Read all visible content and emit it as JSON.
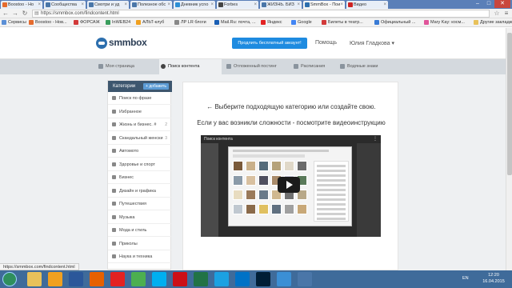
{
  "browser": {
    "tabs": [
      {
        "label": "Boostoo - Нo",
        "color": "#e56b2e"
      },
      {
        "label": "Сообщества",
        "color": "#4a76a8"
      },
      {
        "label": "Смотри и уд",
        "color": "#4a76a8"
      },
      {
        "label": "Полезное обс",
        "color": "#4a76a8"
      },
      {
        "label": "Дневник ycno",
        "color": "#2d8fd5"
      },
      {
        "label": "Forbes",
        "color": "#444444"
      },
      {
        "label": "ЖИЗНЬ. БИЗ",
        "color": "#4a76a8"
      },
      {
        "label": "SmmBox - Пои",
        "color": "#2d6fae"
      },
      {
        "label": "Видео",
        "color": "#cc2222"
      }
    ],
    "url": "https://smmbox.com/findcontent.html",
    "bookmarks": [
      {
        "label": "Сервисы",
        "color": "#5b8fd6"
      },
      {
        "label": "Boostoo - Нов...",
        "color": "#e56b2e"
      },
      {
        "label": "ФОРСАЖ",
        "color": "#d23a3a"
      },
      {
        "label": "InWEB24",
        "color": "#3a9d5d"
      },
      {
        "label": "АЛЬТ-клуб",
        "color": "#f0a020"
      },
      {
        "label": "ЛР LR блоги",
        "color": "#888888"
      },
      {
        "label": "Mail.Ru: почта, ...",
        "color": "#1a5fb4"
      },
      {
        "label": "Яндекс",
        "color": "#e32222"
      },
      {
        "label": "Google",
        "color": "#4285f4"
      },
      {
        "label": "Билеты в театр...",
        "color": "#d23a3a"
      },
      {
        "label": "Официальный ...",
        "color": "#3a7bd5"
      },
      {
        "label": "Mary Kay: косм...",
        "color": "#e0559a"
      },
      {
        "label": "Другие закладки",
        "color": "#e8c15a"
      }
    ]
  },
  "site": {
    "logo": "smmbox",
    "cta": "Продлить бесплатный аккаунт!",
    "help": "Помощь",
    "user": "Юлия Гладкова ▾",
    "nav": [
      {
        "label": "Моя страница"
      },
      {
        "label": "Поиск контента",
        "active": true
      },
      {
        "label": "Отложенный постинг"
      },
      {
        "label": "Расписания"
      },
      {
        "label": "Водяные знаки"
      }
    ]
  },
  "sidebar": {
    "title": "Категории",
    "add_label": "+ добавить",
    "items": [
      {
        "label": "Поиск по фразе",
        "count": ""
      },
      {
        "label": "Избранное",
        "count": ""
      },
      {
        "label": "Жизнь и бизнес. #",
        "count": "2"
      },
      {
        "label": "Скандальный женски",
        "count": "3"
      },
      {
        "label": "Автомото",
        "count": ""
      },
      {
        "label": "Здоровье и спорт",
        "count": ""
      },
      {
        "label": "Бизнес",
        "count": ""
      },
      {
        "label": "Дизайн и графика",
        "count": ""
      },
      {
        "label": "Путешествия",
        "count": ""
      },
      {
        "label": "Музыка",
        "count": ""
      },
      {
        "label": "Мода и стиль",
        "count": ""
      },
      {
        "label": "Приколы",
        "count": ""
      },
      {
        "label": "Наука и техника",
        "count": ""
      }
    ]
  },
  "main": {
    "hint1": "← Выберите подходящую категорию или создайте свою.",
    "hint2": "Если у вас возникли сложности - посмотрите видеоинструкцию",
    "video_title": "Поиск контента"
  },
  "status_url": "https://smmbox.com/findcontent.html",
  "taskbar": {
    "lang": "EN",
    "time": "12:20",
    "date": "16.04.2015"
  }
}
